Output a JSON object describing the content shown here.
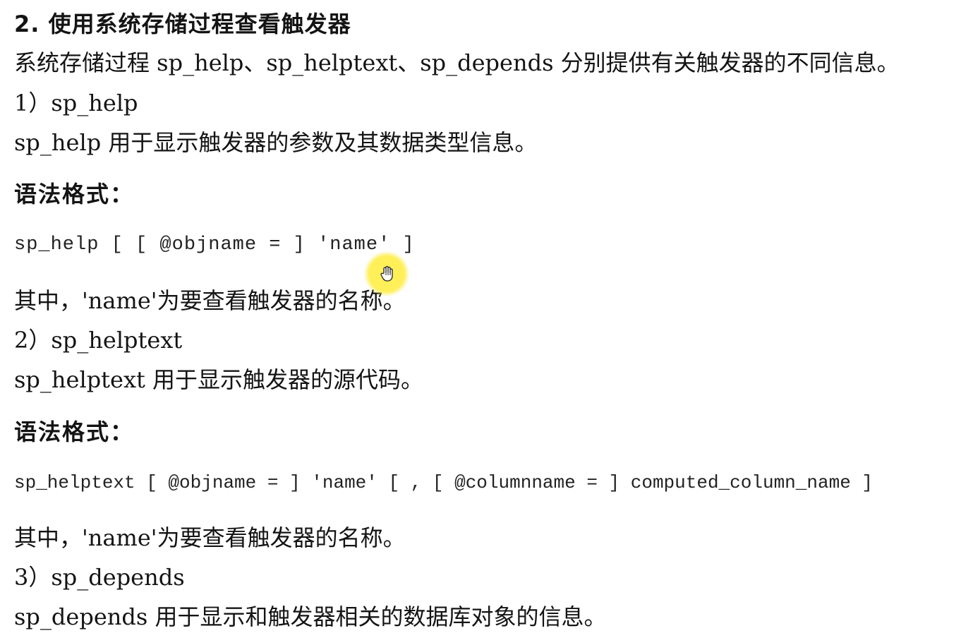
{
  "section": {
    "heading": "2. 使用系统存储过程查看触发器",
    "intro": "系统存储过程 sp_help、sp_helptext、sp_depends 分别提供有关触发器的不同信息。"
  },
  "sp_help": {
    "title": "1）sp_help",
    "description": "sp_help 用于显示触发器的参数及其数据类型信息。",
    "syntax_label": "语法格式：",
    "syntax": "sp_help [ [ @objname = ] 'name' ]",
    "note": "其中，'name'为要查看触发器的名称。"
  },
  "sp_helptext": {
    "title": "2）sp_helptext",
    "description": "sp_helptext 用于显示触发器的源代码。",
    "syntax_label": "语法格式：",
    "syntax": "sp_helptext [ @objname = ] 'name' [ , [ @columnname = ] computed_column_name ]",
    "note": "其中，'name'为要查看触发器的名称。"
  },
  "sp_depends": {
    "title": "3）sp_depends",
    "description": "sp_depends 用于显示和触发器相关的数据库对象的信息。"
  },
  "cursor": {
    "icon": "hand-pointer-icon",
    "highlight_color": "#fff050"
  }
}
